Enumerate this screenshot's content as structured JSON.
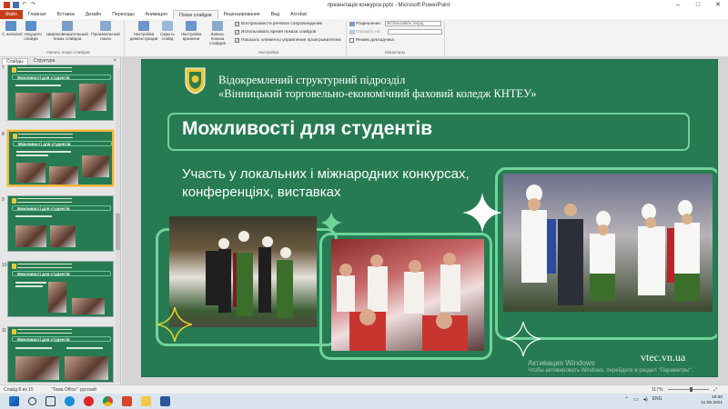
{
  "window": {
    "title": "презентація конкурси.pptx - Microsoft PowerPoint",
    "controls": [
      "–",
      "□",
      "✕"
    ]
  },
  "ribbon_tabs": [
    "Файл",
    "Главная",
    "Вставка",
    "Дизайн",
    "Переходы",
    "Анимация",
    "Показ слайдов",
    "Рецензирование",
    "Вид",
    "Acrobat"
  ],
  "ribbon": {
    "buttons": [
      {
        "label": "С начала"
      },
      {
        "label": "С текущего слайда"
      },
      {
        "label": "Широковещательный показ слайдов"
      },
      {
        "label": "Произвольный показ"
      },
      {
        "label": "Настройка демонстрации"
      },
      {
        "label": "Скрыть слайд"
      },
      {
        "label": "Настройка времени"
      },
      {
        "label": "Запись показа слайдов"
      }
    ],
    "group_labels": [
      "Начать показ слайдов",
      "Настройка",
      "Мониторы"
    ],
    "checkboxes": [
      {
        "label": "Воспроизвести речевое сопровождение"
      },
      {
        "label": "Использовать время показа слайдов"
      },
      {
        "label": "Показать элементы управления проигрывателем"
      },
      {
        "label": "Режим докладчика"
      }
    ],
    "resolution_label": "Разрешение:",
    "resolution_value": "Использовать текущ...",
    "show_on_label": "Показать на:"
  },
  "left_pane": {
    "tabs": [
      "Слайды",
      "Структура"
    ],
    "close": "×",
    "slide_numbers": [
      "7",
      "8",
      "9",
      "10",
      "11"
    ],
    "thumb_title": "Можливості для студентів"
  },
  "slide": {
    "org_line1": "Відокремлений структурний підрозділ",
    "org_line2": "«Вінницький торговельно-економічний фаховий коледж КНТЕУ»",
    "title": "Можливості для студентів",
    "subtitle_line1": "Участь у локальних і міжнародних конкурсах,",
    "subtitle_line2": "конференціях, виставках",
    "url": "vtec.vn.ua"
  },
  "activation": {
    "line1": "Активация Windows",
    "line2": "Чтобы активировать Windows, перейдите в раздел \"Параметры\"."
  },
  "status_bar": {
    "slide_info": "Слайд 8 из 15",
    "theme": "\"Тема Office\"",
    "language": "русский",
    "zoom": "117%",
    "zoom_level": 0.58
  },
  "taskbar": {
    "apps": [
      "windows-start",
      "search",
      "task-view",
      "edge",
      "opera",
      "chrome",
      "powerpoint",
      "explorer",
      "word"
    ],
    "lang": "ENG",
    "time": "15:20",
    "date": "11.05.2021"
  }
}
